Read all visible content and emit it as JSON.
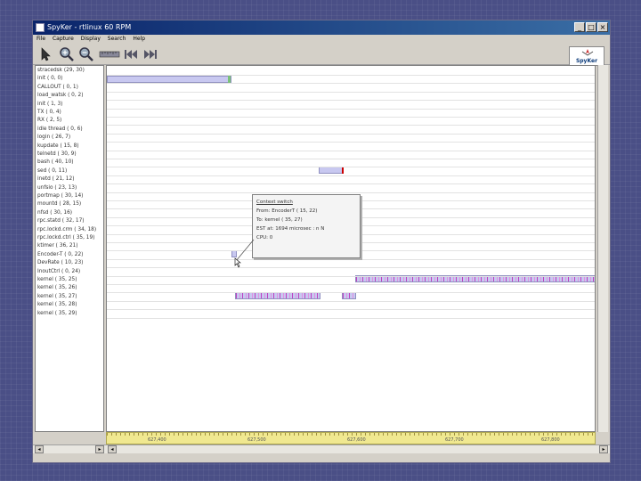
{
  "window": {
    "title": "SpyKer - rtlinux 60 RPM",
    "minimize": "_",
    "maximize": "□",
    "close": "×"
  },
  "menu": [
    "File",
    "Capture",
    "Display",
    "Search",
    "Help"
  ],
  "toolbar": {
    "icons": [
      "pointer-icon",
      "zoom-in-icon",
      "zoom-out-icon",
      "ruler-icon",
      "skip-back-icon",
      "skip-forward-icon"
    ]
  },
  "logo": {
    "text": "SpyKer"
  },
  "processes": [
    "stracedsk (29, 30)",
    "init ( 0, 0)",
    "CALLOUT ( 0, 1)",
    "load_watsk ( 0, 2)",
    "init ( 1, 3)",
    "TX ( 0, 4)",
    "RX ( 2, 5)",
    "idle thread ( 0, 6)",
    "login ( 26, 7)",
    "kupdate ( 15, 8)",
    "telnetd ( 30, 9)",
    "bash ( 40, 10)",
    "sed ( 0, 11)",
    "inetd ( 21, 12)",
    "unfsio ( 23, 13)",
    "portmap ( 30, 14)",
    "mountd ( 28, 15)",
    "nfsd ( 30, 16)",
    "rpc.statd ( 32, 17)",
    "rpc.lockd.crm ( 34, 18)",
    "rpc.lockd.ctrl ( 35, 19)",
    "ktimer ( 36, 21)",
    "Encoder-T ( 0, 22)",
    "DevRate ( 10, 23)",
    "InoutCtrl ( 0, 24)",
    "kernel ( 35, 25)",
    "kernel ( 35, 26)",
    "kernel ( 35, 27)",
    "kernel ( 35, 28)",
    "kernel ( 35, 29)"
  ],
  "tooltip": {
    "lines": [
      "Context switch",
      "From: EncoderT ( 15, 22)",
      "To: kernel ( 35, 27)",
      "EST at: 1694 microsec : n N",
      "CPU: 0"
    ]
  },
  "ruler": {
    "ticks": [
      "627,400",
      "627,500",
      "627,600",
      "627,700",
      "627,800"
    ]
  },
  "colors": {
    "bar": "#c8c8f0",
    "stripe": "#c040c0",
    "ruler": "#f0e890"
  }
}
